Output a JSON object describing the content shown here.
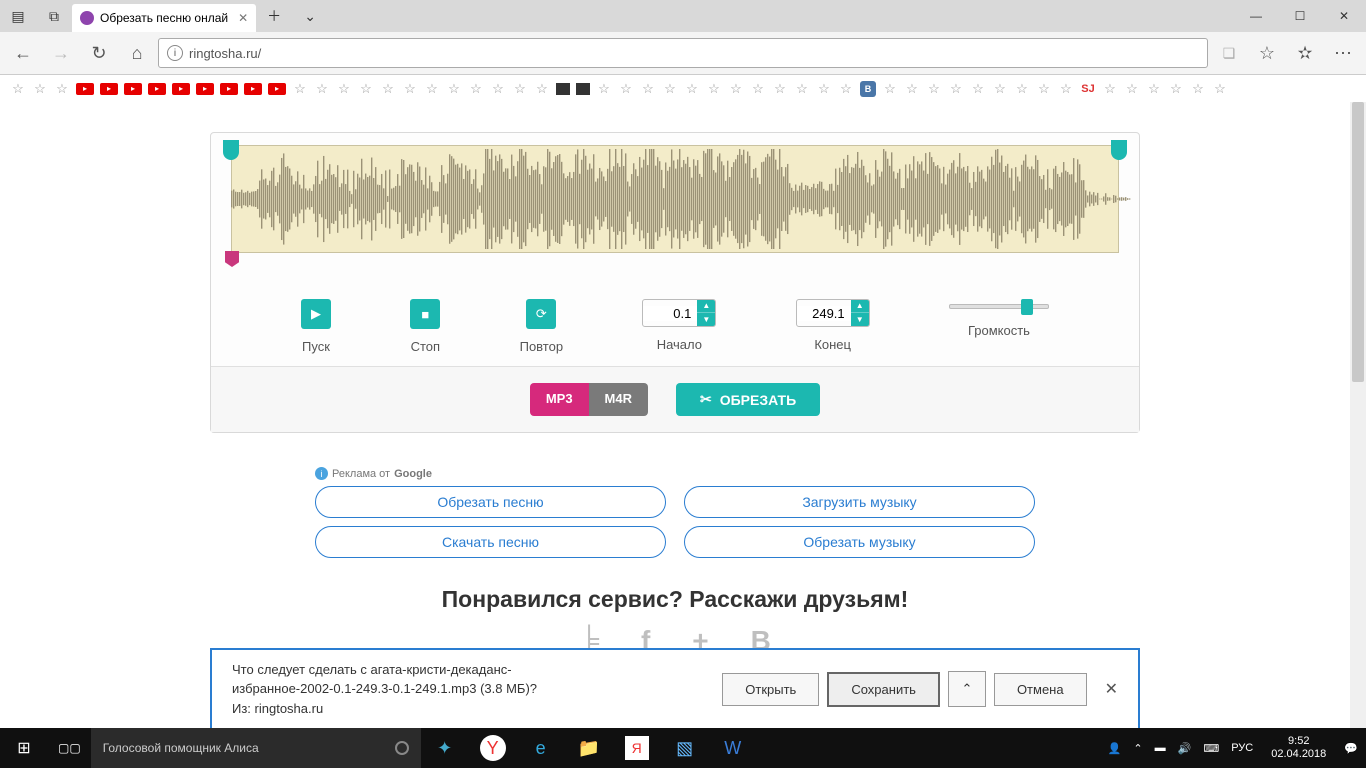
{
  "tab": {
    "title": "Обрезать песню онлай"
  },
  "url": "ringtosha.ru/",
  "controls": {
    "play": "Пуск",
    "stop": "Стоп",
    "repeat": "Повтор",
    "start_label": "Начало",
    "start_val": "0.1",
    "end_label": "Конец",
    "end_val": "249.1",
    "volume": "Громкость"
  },
  "formats": {
    "mp3": "MP3",
    "m4r": "M4R"
  },
  "cut": "ОБРЕЗАТЬ",
  "ads": {
    "label_prefix": "Реклама от ",
    "label_brand": "Google",
    "b1": "Обрезать песню",
    "b2": "Загрузить музыку",
    "b3": "Скачать песню",
    "b4": "Обрезать музыку"
  },
  "share_heading": "Понравился сервис? Расскажи друзьям!",
  "download": {
    "line1": "Что следует сделать с агата-кристи-декаданс-",
    "line2": "избранное-2002-0.1-249.3-0.1-249.1.mp3 (3.8 МБ)?",
    "line3": "Из: ringtosha.ru",
    "open": "Открыть",
    "save": "Сохранить",
    "cancel": "Отмена"
  },
  "taskbar": {
    "search": "Голосовой помощник Алиса",
    "lang": "РУС",
    "time": "9:52",
    "date": "02.04.2018"
  }
}
